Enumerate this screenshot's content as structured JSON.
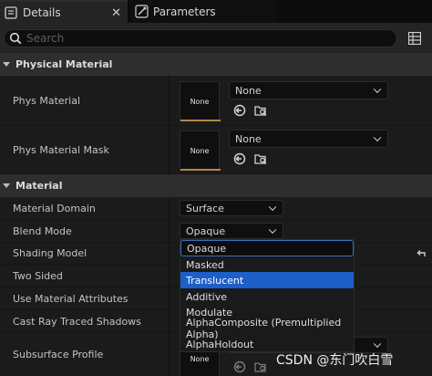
{
  "tabs": {
    "details": {
      "label": "Details",
      "close": "✕"
    },
    "parameters": {
      "label": "Parameters"
    }
  },
  "search": {
    "placeholder": "Search"
  },
  "categories": {
    "physical_material": "Physical Material",
    "material": "Material"
  },
  "physical_material": {
    "phys_material": {
      "label": "Phys Material",
      "thumb": "None",
      "value": "None"
    },
    "phys_material_mask": {
      "label": "Phys Material Mask",
      "thumb": "None",
      "value": "None"
    }
  },
  "material": {
    "material_domain": {
      "label": "Material Domain",
      "value": "Surface"
    },
    "blend_mode": {
      "label": "Blend Mode",
      "value": "Opaque"
    },
    "shading_model": {
      "label": "Shading Model"
    },
    "two_sided": {
      "label": "Two Sided"
    },
    "use_material_attributes": {
      "label": "Use Material Attributes"
    },
    "cast_ray_traced_shadows": {
      "label": "Cast Ray Traced Shadows"
    },
    "subsurface_profile": {
      "label": "Subsurface Profile",
      "thumb": "None"
    }
  },
  "blend_mode_dropdown": {
    "current": "Opaque",
    "options": [
      "Masked",
      "Translucent",
      "Additive",
      "Modulate",
      "AlphaComposite (Premultiplied Alpha)",
      "AlphaHoldout"
    ],
    "highlighted": "Translucent"
  },
  "watermark": "CSDN @东门吹白雪",
  "colors": {
    "highlight": "#1c5fc8",
    "thumb_accent": "#b2874f",
    "search_focus": "#3a6fc0"
  }
}
